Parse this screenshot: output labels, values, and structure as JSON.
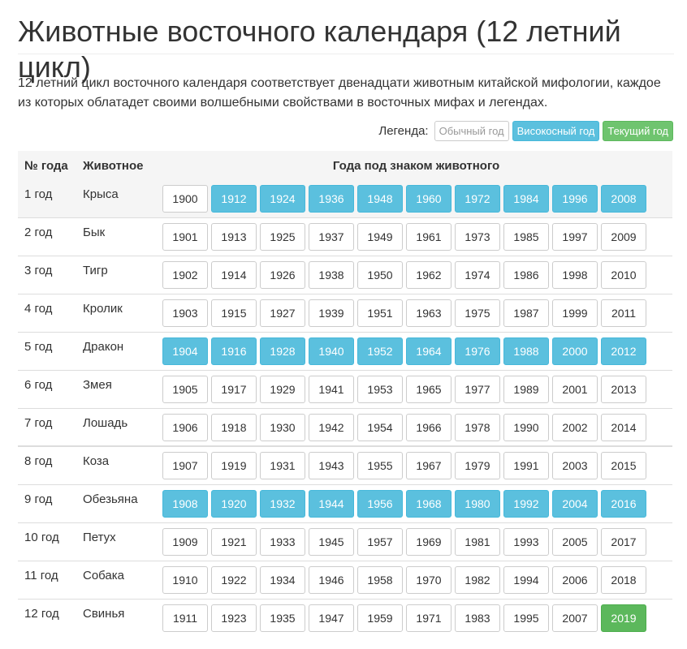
{
  "page": {
    "title": "Животные восточного календаря (12 летний цикл)",
    "description": "12 летний цикл восточного календаря соответствует двенадцати животным китайской мифологии, каждое из которых облатадет своими волшебными свойствами в восточных мифах и легендах."
  },
  "legend": {
    "label": "Легенда:",
    "normal": "Обычный год",
    "leap": "Високосный год",
    "current": "Текущий год"
  },
  "colors": {
    "leap": "#5bc0de",
    "current": "#5cb85c",
    "normal_border": "#cccccc"
  },
  "table": {
    "headers": [
      "№ года",
      "Животное",
      "Года под знаком животного"
    ],
    "rows": [
      {
        "num": "1 год",
        "animal": "Крыса",
        "years": [
          {
            "y": "1900",
            "t": "normal"
          },
          {
            "y": "1912",
            "t": "leap"
          },
          {
            "y": "1924",
            "t": "leap"
          },
          {
            "y": "1936",
            "t": "leap"
          },
          {
            "y": "1948",
            "t": "leap"
          },
          {
            "y": "1960",
            "t": "leap"
          },
          {
            "y": "1972",
            "t": "leap"
          },
          {
            "y": "1984",
            "t": "leap"
          },
          {
            "y": "1996",
            "t": "leap"
          },
          {
            "y": "2008",
            "t": "leap"
          }
        ]
      },
      {
        "num": "2 год",
        "animal": "Бык",
        "years": [
          {
            "y": "1901",
            "t": "normal"
          },
          {
            "y": "1913",
            "t": "normal"
          },
          {
            "y": "1925",
            "t": "normal"
          },
          {
            "y": "1937",
            "t": "normal"
          },
          {
            "y": "1949",
            "t": "normal"
          },
          {
            "y": "1961",
            "t": "normal"
          },
          {
            "y": "1973",
            "t": "normal"
          },
          {
            "y": "1985",
            "t": "normal"
          },
          {
            "y": "1997",
            "t": "normal"
          },
          {
            "y": "2009",
            "t": "normal"
          }
        ]
      },
      {
        "num": "3 год",
        "animal": "Тигр",
        "years": [
          {
            "y": "1902",
            "t": "normal"
          },
          {
            "y": "1914",
            "t": "normal"
          },
          {
            "y": "1926",
            "t": "normal"
          },
          {
            "y": "1938",
            "t": "normal"
          },
          {
            "y": "1950",
            "t": "normal"
          },
          {
            "y": "1962",
            "t": "normal"
          },
          {
            "y": "1974",
            "t": "normal"
          },
          {
            "y": "1986",
            "t": "normal"
          },
          {
            "y": "1998",
            "t": "normal"
          },
          {
            "y": "2010",
            "t": "normal"
          }
        ]
      },
      {
        "num": "4 год",
        "animal": "Кролик",
        "years": [
          {
            "y": "1903",
            "t": "normal"
          },
          {
            "y": "1915",
            "t": "normal"
          },
          {
            "y": "1927",
            "t": "normal"
          },
          {
            "y": "1939",
            "t": "normal"
          },
          {
            "y": "1951",
            "t": "normal"
          },
          {
            "y": "1963",
            "t": "normal"
          },
          {
            "y": "1975",
            "t": "normal"
          },
          {
            "y": "1987",
            "t": "normal"
          },
          {
            "y": "1999",
            "t": "normal"
          },
          {
            "y": "2011",
            "t": "normal"
          }
        ]
      },
      {
        "num": "5 год",
        "animal": "Дракон",
        "years": [
          {
            "y": "1904",
            "t": "leap"
          },
          {
            "y": "1916",
            "t": "leap"
          },
          {
            "y": "1928",
            "t": "leap"
          },
          {
            "y": "1940",
            "t": "leap"
          },
          {
            "y": "1952",
            "t": "leap"
          },
          {
            "y": "1964",
            "t": "leap"
          },
          {
            "y": "1976",
            "t": "leap"
          },
          {
            "y": "1988",
            "t": "leap"
          },
          {
            "y": "2000",
            "t": "leap"
          },
          {
            "y": "2012",
            "t": "leap"
          }
        ]
      },
      {
        "num": "6 год",
        "animal": "Змея",
        "years": [
          {
            "y": "1905",
            "t": "normal"
          },
          {
            "y": "1917",
            "t": "normal"
          },
          {
            "y": "1929",
            "t": "normal"
          },
          {
            "y": "1941",
            "t": "normal"
          },
          {
            "y": "1953",
            "t": "normal"
          },
          {
            "y": "1965",
            "t": "normal"
          },
          {
            "y": "1977",
            "t": "normal"
          },
          {
            "y": "1989",
            "t": "normal"
          },
          {
            "y": "2001",
            "t": "normal"
          },
          {
            "y": "2013",
            "t": "normal"
          }
        ]
      },
      {
        "num": "7 год",
        "animal": "Лошадь",
        "years": [
          {
            "y": "1906",
            "t": "normal"
          },
          {
            "y": "1918",
            "t": "normal"
          },
          {
            "y": "1930",
            "t": "normal"
          },
          {
            "y": "1942",
            "t": "normal"
          },
          {
            "y": "1954",
            "t": "normal"
          },
          {
            "y": "1966",
            "t": "normal"
          },
          {
            "y": "1978",
            "t": "normal"
          },
          {
            "y": "1990",
            "t": "normal"
          },
          {
            "y": "2002",
            "t": "normal"
          },
          {
            "y": "2014",
            "t": "normal"
          }
        ]
      },
      {
        "num": "8 год",
        "animal": "Коза",
        "years": [
          {
            "y": "1907",
            "t": "normal"
          },
          {
            "y": "1919",
            "t": "normal"
          },
          {
            "y": "1931",
            "t": "normal"
          },
          {
            "y": "1943",
            "t": "normal"
          },
          {
            "y": "1955",
            "t": "normal"
          },
          {
            "y": "1967",
            "t": "normal"
          },
          {
            "y": "1979",
            "t": "normal"
          },
          {
            "y": "1991",
            "t": "normal"
          },
          {
            "y": "2003",
            "t": "normal"
          },
          {
            "y": "2015",
            "t": "normal"
          }
        ]
      },
      {
        "num": "9 год",
        "animal": "Обезьяна",
        "years": [
          {
            "y": "1908",
            "t": "leap"
          },
          {
            "y": "1920",
            "t": "leap"
          },
          {
            "y": "1932",
            "t": "leap"
          },
          {
            "y": "1944",
            "t": "leap"
          },
          {
            "y": "1956",
            "t": "leap"
          },
          {
            "y": "1968",
            "t": "leap"
          },
          {
            "y": "1980",
            "t": "leap"
          },
          {
            "y": "1992",
            "t": "leap"
          },
          {
            "y": "2004",
            "t": "leap"
          },
          {
            "y": "2016",
            "t": "leap"
          }
        ]
      },
      {
        "num": "10 год",
        "animal": "Петух",
        "years": [
          {
            "y": "1909",
            "t": "normal"
          },
          {
            "y": "1921",
            "t": "normal"
          },
          {
            "y": "1933",
            "t": "normal"
          },
          {
            "y": "1945",
            "t": "normal"
          },
          {
            "y": "1957",
            "t": "normal"
          },
          {
            "y": "1969",
            "t": "normal"
          },
          {
            "y": "1981",
            "t": "normal"
          },
          {
            "y": "1993",
            "t": "normal"
          },
          {
            "y": "2005",
            "t": "normal"
          },
          {
            "y": "2017",
            "t": "normal"
          }
        ]
      },
      {
        "num": "11 год",
        "animal": "Собака",
        "years": [
          {
            "y": "1910",
            "t": "normal"
          },
          {
            "y": "1922",
            "t": "normal"
          },
          {
            "y": "1934",
            "t": "normal"
          },
          {
            "y": "1946",
            "t": "normal"
          },
          {
            "y": "1958",
            "t": "normal"
          },
          {
            "y": "1970",
            "t": "normal"
          },
          {
            "y": "1982",
            "t": "normal"
          },
          {
            "y": "1994",
            "t": "normal"
          },
          {
            "y": "2006",
            "t": "normal"
          },
          {
            "y": "2018",
            "t": "normal"
          }
        ]
      },
      {
        "num": "12 год",
        "animal": "Свинья",
        "years": [
          {
            "y": "1911",
            "t": "normal"
          },
          {
            "y": "1923",
            "t": "normal"
          },
          {
            "y": "1935",
            "t": "normal"
          },
          {
            "y": "1947",
            "t": "normal"
          },
          {
            "y": "1959",
            "t": "normal"
          },
          {
            "y": "1971",
            "t": "normal"
          },
          {
            "y": "1983",
            "t": "normal"
          },
          {
            "y": "1995",
            "t": "normal"
          },
          {
            "y": "2007",
            "t": "normal"
          },
          {
            "y": "2019",
            "t": "current"
          }
        ]
      }
    ]
  }
}
